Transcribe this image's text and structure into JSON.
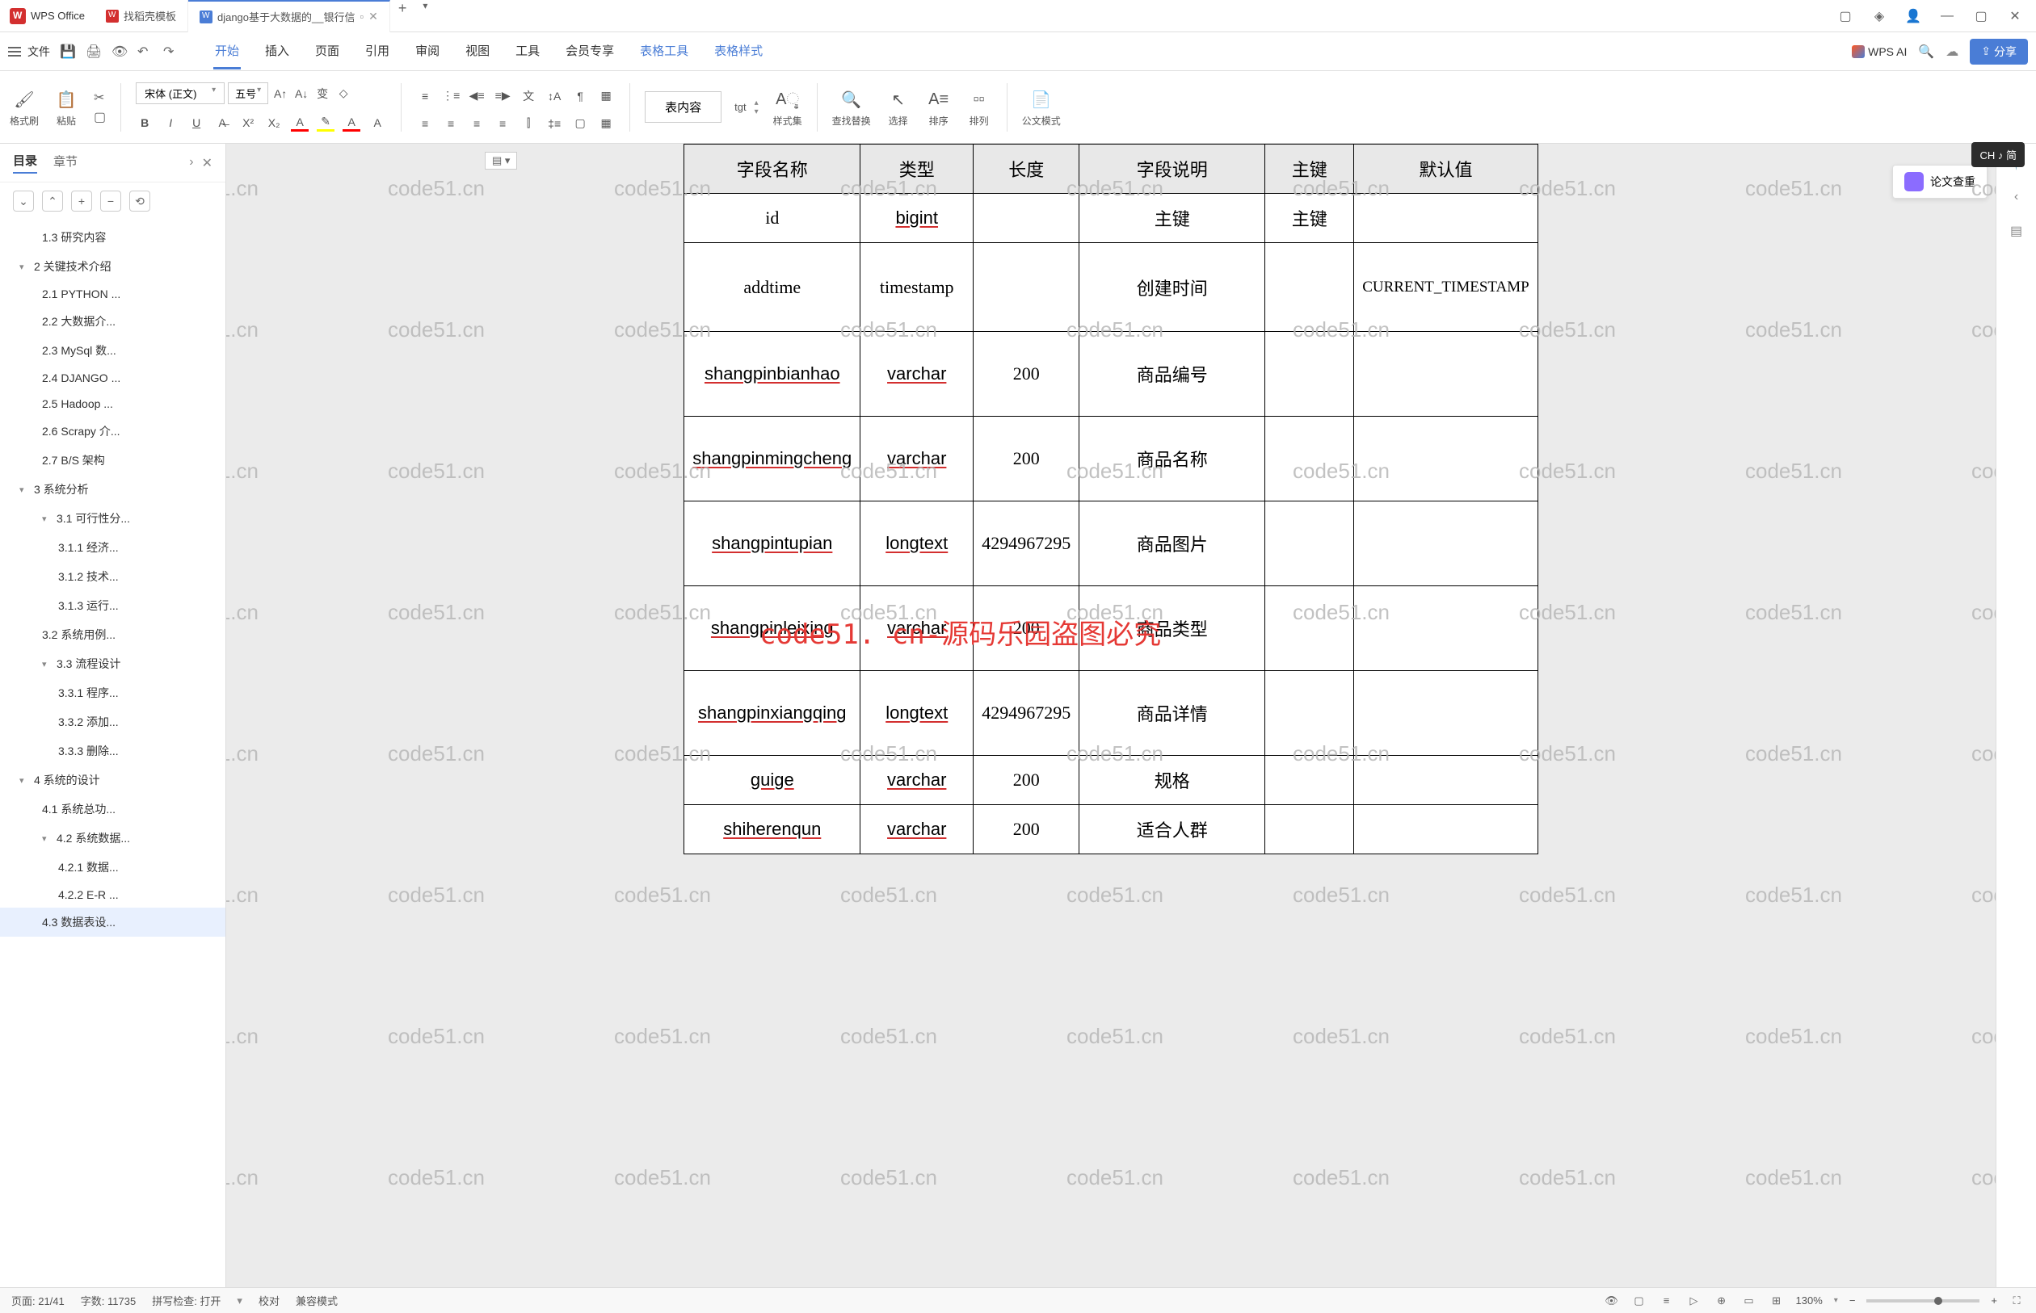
{
  "app": {
    "name": "WPS Office"
  },
  "tabs": [
    {
      "label": "找稻壳模板",
      "active": false
    },
    {
      "label": "django基于大数据的__银行信",
      "active": true
    }
  ],
  "menu": {
    "file": "文件",
    "items": [
      "开始",
      "插入",
      "页面",
      "引用",
      "审阅",
      "视图",
      "工具",
      "会员专享",
      "表格工具",
      "表格样式"
    ],
    "wps_ai": "WPS AI",
    "share": "分享"
  },
  "ribbon": {
    "format_brush": "格式刷",
    "paste": "粘贴",
    "font_name": "宋体 (正文)",
    "font_size": "五号",
    "style_active": "表内容",
    "style_tgt": "tgt",
    "styles": "样式集",
    "find_replace": "查找替换",
    "select": "选择",
    "sort": "排序",
    "sort2": "排列",
    "official": "公文模式"
  },
  "sidebar": {
    "tabs": [
      "目录",
      "章节"
    ],
    "toc": [
      {
        "label": "1.3 研究内容",
        "level": 2
      },
      {
        "label": "2  关键技术介绍",
        "level": 1,
        "exp": true
      },
      {
        "label": "2.1 PYTHON ...",
        "level": 2
      },
      {
        "label": "2.2 大数据介...",
        "level": 2
      },
      {
        "label": "2.3 MySql 数...",
        "level": 2
      },
      {
        "label": "2.4 DJANGO ...",
        "level": 2
      },
      {
        "label": "2.5 Hadoop ...",
        "level": 2
      },
      {
        "label": "2.6 Scrapy 介...",
        "level": 2
      },
      {
        "label": "2.7 B/S 架构",
        "level": 2
      },
      {
        "label": "3  系统分析",
        "level": 1,
        "exp": true
      },
      {
        "label": "3.1 可行性分...",
        "level": 2,
        "exp": true
      },
      {
        "label": "3.1.1 经济...",
        "level": 3
      },
      {
        "label": "3.1.2 技术...",
        "level": 3
      },
      {
        "label": "3.1.3 运行...",
        "level": 3
      },
      {
        "label": "3.2 系统用例...",
        "level": 2
      },
      {
        "label": "3.3 流程设计",
        "level": 2,
        "exp": true
      },
      {
        "label": "3.3.1 程序...",
        "level": 3
      },
      {
        "label": "3.3.2 添加...",
        "level": 3
      },
      {
        "label": "3.3.3 删除...",
        "level": 3
      },
      {
        "label": "4  系统的设计",
        "level": 1,
        "exp": true
      },
      {
        "label": "4.1 系统总功...",
        "level": 2
      },
      {
        "label": "4.2 系统数据...",
        "level": 2,
        "exp": true
      },
      {
        "label": "4.2.1 数据...",
        "level": 3
      },
      {
        "label": "4.2.2 E-R ...",
        "level": 3
      },
      {
        "label": "4.3 数据表设...",
        "level": 2,
        "selected": true
      }
    ]
  },
  "table": {
    "headers": [
      "字段名称",
      "类型",
      "长度",
      "字段说明",
      "主键",
      "默认值"
    ],
    "rows": [
      [
        "id",
        "bigint",
        "",
        "主键",
        "主键",
        ""
      ],
      [
        "addtime",
        "timestamp",
        "",
        "创建时间",
        "",
        "CURRENT_TIMESTAMP"
      ],
      [
        "shangpinbianhao",
        "varchar",
        "200",
        "商品编号",
        "",
        ""
      ],
      [
        "shangpinmingcheng",
        "varchar",
        "200",
        "商品名称",
        "",
        ""
      ],
      [
        "shangpintupian",
        "longtext",
        "4294967295",
        "商品图片",
        "",
        ""
      ],
      [
        "shangpinleixing",
        "varchar",
        "200",
        "商品类型",
        "",
        ""
      ],
      [
        "shangpinxiangqing",
        "longtext",
        "4294967295",
        "商品详情",
        "",
        ""
      ],
      [
        "guige",
        "varchar",
        "200",
        "规格",
        "",
        ""
      ],
      [
        "shiherenqun",
        "varchar",
        "200",
        "适合人群",
        "",
        ""
      ]
    ]
  },
  "watermark": {
    "text": "code51.cn",
    "center": "code51. cn-源码乐园盗图必究"
  },
  "review_btn": "论文查重",
  "ime": "CH ♪ 简",
  "status": {
    "page": "页面: 21/41",
    "words": "字数: 11735",
    "spell": "拼写检查: 打开",
    "proof": "校对",
    "compat": "兼容模式",
    "zoom": "130%"
  }
}
